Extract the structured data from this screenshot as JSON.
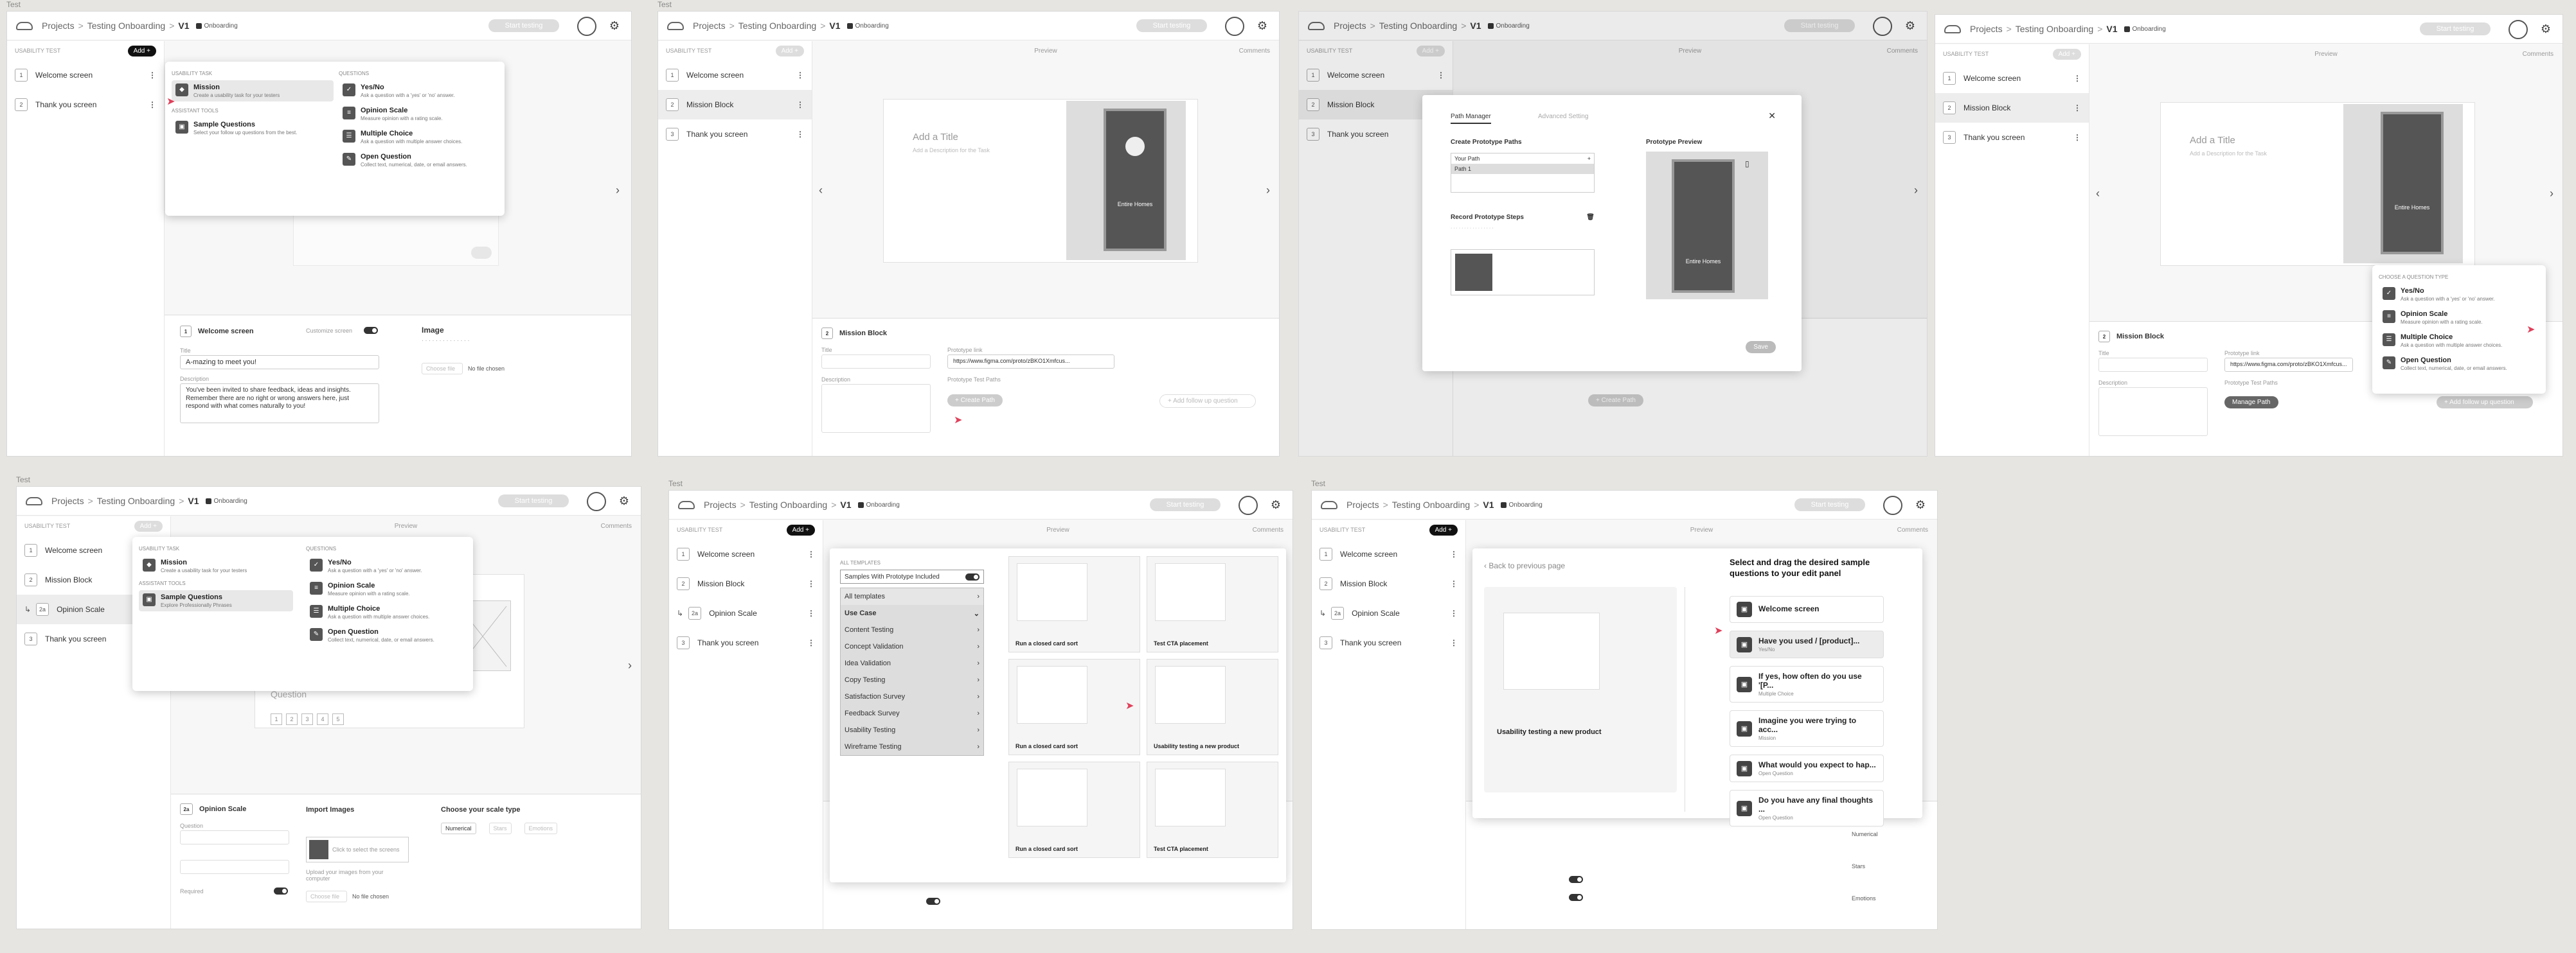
{
  "common": {
    "projects": "Projects",
    "project": "Testing Onboarding",
    "version": "V1",
    "onboarding": "Onboarding",
    "start": "Start testing",
    "usability_test": "USABILITY TEST",
    "add": "Add +",
    "preview": "Preview",
    "comments": "Comments"
  },
  "frames": {
    "f1": "Test",
    "f2": "Test",
    "f5": "Test",
    "f6": "Test",
    "f7": "Test"
  },
  "items": {
    "welcome": "Welcome screen",
    "thanks": "Thank you screen",
    "mission": "Mission Block",
    "opinion": "Opinion Scale"
  },
  "menu": {
    "usability_task": "USABILITY TASK",
    "questions": "QUESTIONS",
    "assistant_tools": "ASSISTANT TOOLS",
    "mission": "Mission",
    "mission_d": "Create a usability task for your testers",
    "sample": "Sample Questions",
    "sample_d": "Select your follow up questions from the best.",
    "sample_d2": "Explore Professionally Phrases",
    "yesno": "Yes/No",
    "yesno_d": "Ask a question with a 'yes' or 'no' answer.",
    "opinion": "Opinion Scale",
    "opinion_d": "Measure opinion with a rating scale.",
    "multiple": "Multiple Choice",
    "multiple_d": "Ask a question with multiple answer choices.",
    "open": "Open Question",
    "open_d": "Collect text, numerical, date, or email answers.",
    "choose_type": "CHOOSE A QUESTION TYPE"
  },
  "welcome_editor": {
    "title": "Welcome screen",
    "customize": "Customize screen",
    "image": "Image",
    "title_label": "Title",
    "title_val": "A-mazing to meet you!",
    "desc_label": "Description",
    "desc_val": "You've been invited to share feedback, ideas and insights. Remember there are no right or wrong answers here, just respond with what comes naturally to you!",
    "choose_file": "Choose file",
    "no_file": "No file chosen"
  },
  "mission_card": {
    "add_title": "Add a Title",
    "add_desc": "Add a Description for the Task",
    "phone_title": "Entire Homes"
  },
  "mission_editor": {
    "title": "Mission Block",
    "title_label": "Title",
    "desc_label": "Description",
    "proto_link": "Prototype link",
    "url": "https://www.figma.com/proto/zBKO1Xmfcus...",
    "paths": "Prototype Test Paths",
    "create_path": "+ Create Path",
    "manage_path": "Manage Path",
    "add_followup": "+ Add follow up question"
  },
  "path_modal": {
    "tab1": "Path Manager",
    "tab2": "Advanced Setting",
    "create": "Create Prototype Paths",
    "your_path": "Your Path",
    "path1": "Path 1",
    "record": "Record Prototype Steps",
    "preview": "Prototype Preview",
    "save": "Save"
  },
  "opinion": {
    "question": "Question",
    "scale": [
      "1",
      "2",
      "3",
      "4",
      "5"
    ],
    "editor_title": "Opinion Scale",
    "import": "Import Images",
    "choose_scale": "Choose your scale type",
    "numerical": "Numerical",
    "stars": "Stars",
    "emotions": "Emotions",
    "required": "Required",
    "click_select": "Click to select the screens",
    "upload_hint": "Upload your images from your computer",
    "choose_file": "Choose file",
    "no_file": "No file chosen"
  },
  "templates": {
    "all": "ALL TEMPLATES",
    "with_proto": "Samples With Prototype Included",
    "all_tpl": "All templates",
    "use_case": "Use Case",
    "cats": [
      "Content Testing",
      "Concept Validation",
      "Idea Validation",
      "Copy Testing",
      "Satisfaction Survey",
      "Feedback Survey",
      "Usability Testing",
      "Wireframe Testing"
    ],
    "cards": [
      "Run a closed card sort",
      "Test CTA placement",
      "Run a closed card sort",
      "Usability testing a new product",
      "Run a closed card sort",
      "Test CTA placement"
    ]
  },
  "sample_q": {
    "back": "Back to previous page",
    "heading": "Select and drag the desired sample questions to your edit panel",
    "card": "Usability testing a new product",
    "q": [
      {
        "t": "Welcome screen",
        "d": ""
      },
      {
        "t": "Have you used / [product]...",
        "d": "Yes/No"
      },
      {
        "t": "If yes, how often do you use '[P...",
        "d": "Multiple Choice"
      },
      {
        "t": "Imagine you were trying to acc...",
        "d": "Mission"
      },
      {
        "t": "What would you expect to hap...",
        "d": "Open Question"
      },
      {
        "t": "Do you have any final thoughts ...",
        "d": "Open Question"
      }
    ]
  }
}
